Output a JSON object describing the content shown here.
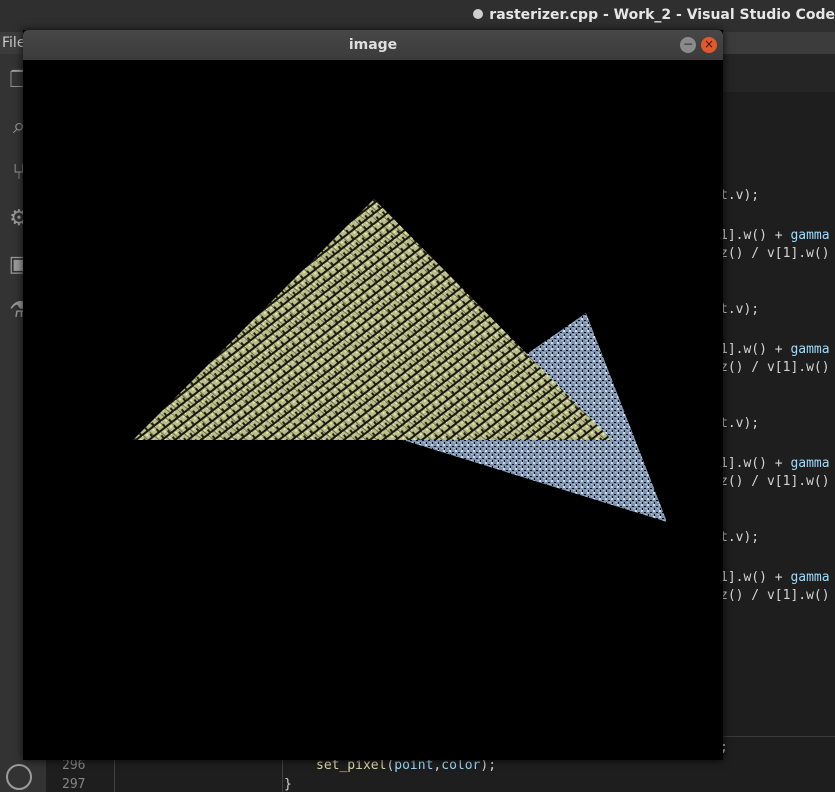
{
  "vscode": {
    "title": "rasterizer.cpp - Work_2 - Visual Studio Code",
    "menu_file": "File",
    "code_lines": [
      {
        "pre": "t.v);",
        "fn": "",
        "var": ""
      },
      {
        "pre": "1].w() + ",
        "fn": "gamma",
        "var": ""
      },
      {
        "pre": "z() / v[1].w()",
        "fn": "",
        "var": ""
      },
      {
        "pre": "t.v);",
        "fn": "",
        "var": ""
      },
      {
        "pre": "1].w() + ",
        "fn": "gamma",
        "var": ""
      },
      {
        "pre": "z() / v[1].w()",
        "fn": "",
        "var": ""
      },
      {
        "pre": "t.v);",
        "fn": "",
        "var": ""
      },
      {
        "pre": "1].w() + ",
        "fn": "gamma",
        "var": ""
      },
      {
        "pre": "z() / v[1].w()",
        "fn": "",
        "var": ""
      },
      {
        "pre": "t.v);",
        "fn": "",
        "var": ""
      },
      {
        "pre": "1].w() + ",
        "fn": "gamma",
        "var": ""
      },
      {
        "pre": "z() / v[1].w()",
        "fn": "",
        "var": ""
      }
    ],
    "semicolon": ";",
    "line_296": "296",
    "line_297": "297",
    "code_296_fn": "set_pixel",
    "code_296_args_point": "point",
    "code_296_args_color": "color",
    "code_296_rest": ");",
    "code_297": "}"
  },
  "image_window": {
    "title": "image",
    "minimize_glyph": "−",
    "close_glyph": "×"
  },
  "colors": {
    "triangle_front": "#d8dcaa",
    "triangle_back": "#b8d0ec"
  }
}
